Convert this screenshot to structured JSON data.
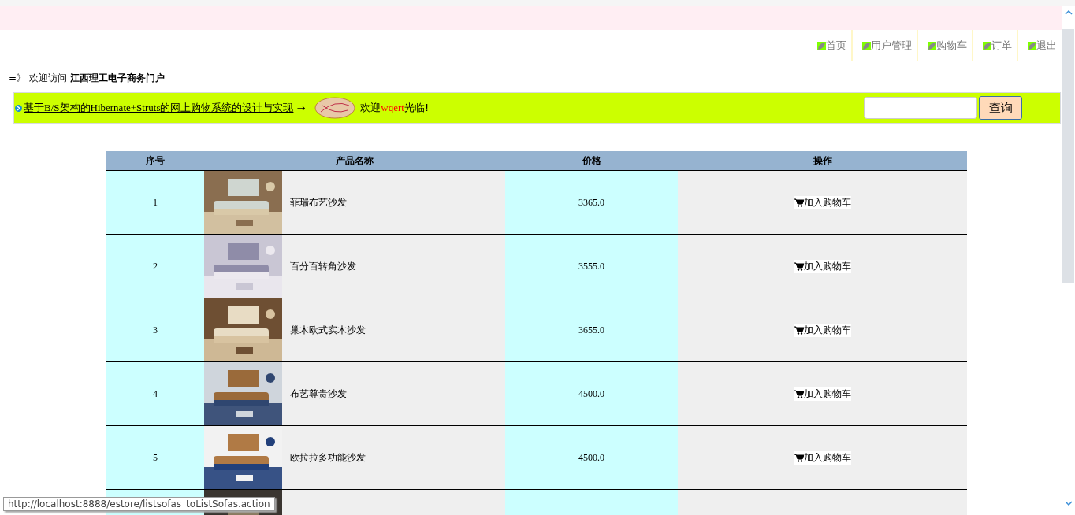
{
  "nav": [
    {
      "label": "首页"
    },
    {
      "label": "用户管理"
    },
    {
      "label": "购物车"
    },
    {
      "label": "订单"
    },
    {
      "label": "退出"
    }
  ],
  "welcome": {
    "prefix": "=》 欢迎访问",
    "site": "江西理工电子商务门户"
  },
  "banner": {
    "link": "基于B/S架构的Hibernate+Struts的网上购物系统的设计与实现",
    "arrow": "→",
    "greet": "欢迎",
    "user": "wqert",
    "suffix": "光临!",
    "search_button": "查询"
  },
  "table": {
    "columns": [
      "序号",
      "产品名称",
      "价格",
      "操作"
    ],
    "rows": [
      {
        "kind": "item",
        "index": "1",
        "name": "菲瑞布艺沙发",
        "price": "3365.0",
        "action": "加入购物车"
      },
      {
        "kind": "item",
        "index": "2",
        "name": "百分百转角沙发",
        "price": "3555.0",
        "action": "加入购物车"
      },
      {
        "kind": "item",
        "index": "3",
        "name": "巢木欧式实木沙发",
        "price": "3655.0",
        "action": "加入购物车"
      },
      {
        "kind": "item",
        "index": "4",
        "name": "布艺尊贵沙发",
        "price": "4500.0",
        "action": "加入购物车"
      },
      {
        "kind": "item",
        "index": "5",
        "name": "欧拉拉多功能沙发",
        "price": "4500.0",
        "action": "加入购物车"
      },
      {
        "kind": "partial"
      }
    ]
  },
  "status_url": "http://localhost:8888/estore/listsofas_toListSofas.action"
}
